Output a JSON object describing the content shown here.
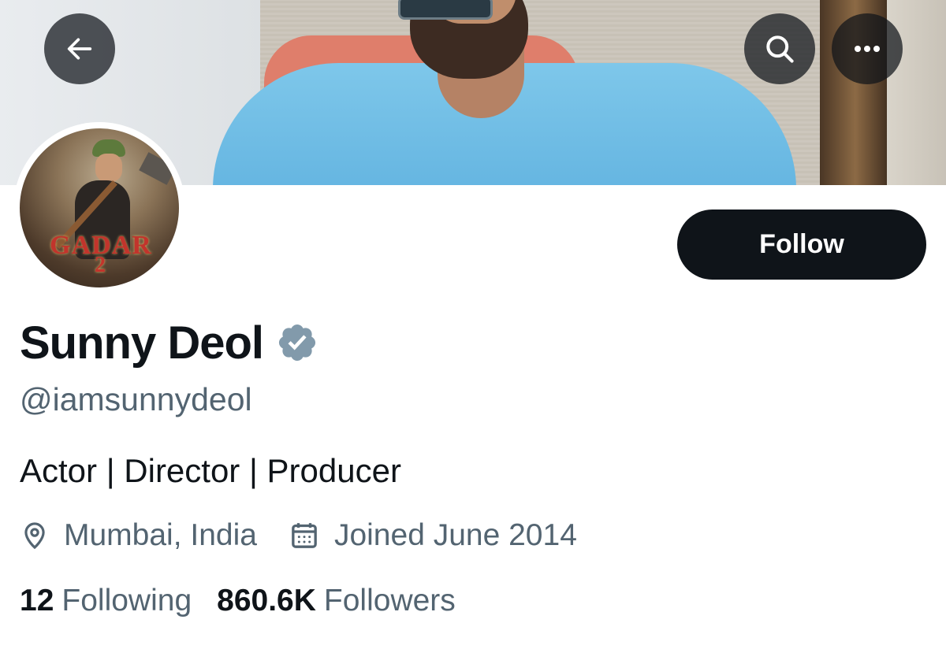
{
  "header": {
    "back_icon": "arrow-left-icon",
    "search_icon": "search-icon",
    "more_icon": "more-horizontal-icon"
  },
  "avatar": {
    "poster_title": "GADAR",
    "poster_number": "2"
  },
  "profile": {
    "follow_label": "Follow",
    "name": "Sunny Deol",
    "verified_icon": "verified-badge-icon",
    "verified_color": "#829aab",
    "handle": "@iamsunnydeol",
    "bio": "Actor | Director | Producer",
    "location": "Mumbai, India",
    "location_icon": "location-pin-icon",
    "joined": "Joined June 2014",
    "joined_icon": "calendar-icon"
  },
  "stats": {
    "following_count": "12",
    "following_label": "Following",
    "followers_count": "860.6K",
    "followers_label": "Followers"
  },
  "colors": {
    "primary_text": "#0f1419",
    "secondary_text": "#536471",
    "button_bg": "#0f1419"
  }
}
